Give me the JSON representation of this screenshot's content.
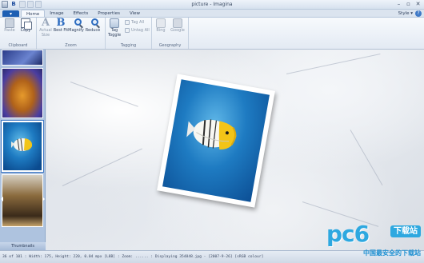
{
  "window": {
    "title": "picture - Imagina",
    "controls": [
      "–",
      "▫",
      "✕"
    ]
  },
  "quick_access": {
    "bold_icon": "B"
  },
  "tabs": {
    "app_button": "▾",
    "items": [
      "Home",
      "Image",
      "Effects",
      "Properties",
      "View"
    ],
    "active": "Home",
    "style_menu": "Style ▾",
    "help": "?"
  },
  "ribbon": {
    "clipboard": {
      "label": "Clipboard",
      "paste": "Paste",
      "copy": "Copy"
    },
    "zoom": {
      "label": "Zoom",
      "actual": "Actual Size",
      "best": "Best Fit",
      "magnify": "Magnify",
      "reduce": "Reduce"
    },
    "tagging": {
      "label": "Tagging",
      "toggle": "Tag Toggle",
      "tag_all": "Tag All",
      "untag_all": "Untag All"
    },
    "geography": {
      "label": "Geography",
      "bing": "Bing",
      "google": "Google"
    }
  },
  "thumbnails": {
    "label": "Thumbnails",
    "selected_index": 2
  },
  "status": {
    "text": "36 of 101  :  Width: 175, Height: 220, 0.04 mpx [L8B]  :  Zoom: ......  :  Displaying 354848.jpg - [2007-9-26]  [sRGB colour]"
  },
  "watermark": {
    "logo": "pc6",
    "badge": "下载站",
    "tagline": "中国最安全的下载站"
  }
}
